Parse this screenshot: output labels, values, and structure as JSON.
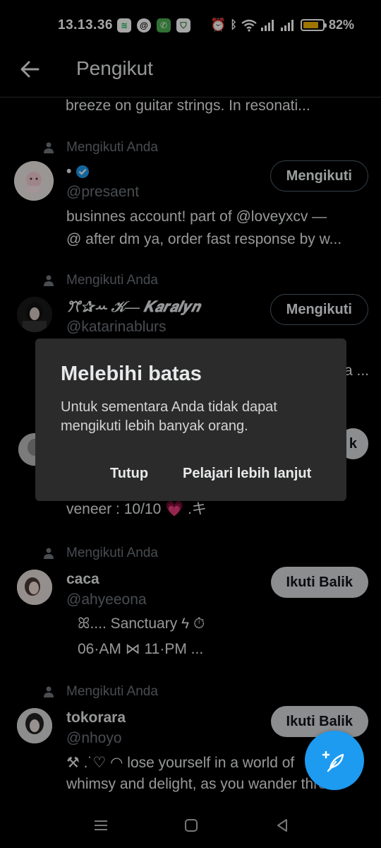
{
  "status_bar": {
    "time": "13.13.36",
    "battery": "82%",
    "battery_level": 0.82
  },
  "header": {
    "title": "Pengikut"
  },
  "list": {
    "clipped_bio": "breeze on guitar strings. In resonati...",
    "items": [
      {
        "follows_label": "Mengikuti Anda",
        "name": "•",
        "verified": true,
        "handle": "@presaent",
        "button": "Mengikuti",
        "bio_1": "businnes account! part of @loveyxcv —",
        "bio_2": "@ after dm ya, order fast response by w..."
      },
      {
        "follows_label": "Mengikuti Anda",
        "name": "ꔫ✰ꕀ 𝒦— 𝑲𝒂𝒓𝒂𝒍𝒚𝒏",
        "handle": "@katarinablurs",
        "button": "Mengikuti",
        "bio_tail": "a ..."
      },
      {
        "button_tail": "k",
        "bio_1": "veneer : 10/10 💗 .キ"
      },
      {
        "follows_label": "Mengikuti Anda",
        "name": "caca",
        "handle": "@ahyeeona",
        "button": "Ikuti Balik",
        "bio_1": "ꕤ....  Sanctuary  ϟ  ⏱",
        "bio_2": "06·AM  ⋈  11·PM  ..."
      },
      {
        "follows_label": "Mengikuti Anda",
        "name": "tokorara",
        "handle": "@nhoyo",
        "button": "Ikuti Balik",
        "bio_1": "⚒ .˙♡ ◠ lose yourself in a world of",
        "bio_2": "whimsy and delight, as you wander thro..."
      }
    ]
  },
  "dialog": {
    "title": "Melebihi batas",
    "message": "Untuk sementara Anda tidak dapat mengikuti lebih banyak orang.",
    "close_label": "Tutup",
    "learn_more_label": "Pelajari lebih lanjut"
  },
  "colors": {
    "background": "#000000",
    "accent": "#1d9bf0",
    "muted_text": "#71767b",
    "dialog_bg": "#2b2b2b"
  }
}
